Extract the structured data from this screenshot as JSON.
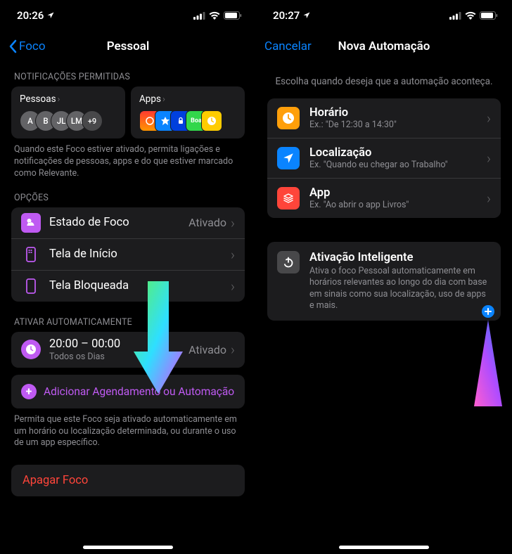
{
  "left": {
    "status": {
      "time": "20:26"
    },
    "nav": {
      "back": "Foco",
      "title": "Pessoal"
    },
    "notif": {
      "header": "NOTIFICAÇÕES PERMITIDAS",
      "pessoas_label": "Pessoas",
      "apps_label": "Apps",
      "avatars": [
        "A",
        "B",
        "JL",
        "LM"
      ],
      "avatar_more": "+9",
      "footnote": "Quando este Foco estiver ativado, permita ligações e notificações de pessoas, apps e do que estiver marcado como Relevante."
    },
    "options": {
      "header": "OPÇÕES",
      "estado": {
        "title": "Estado de Foco",
        "trail": "Ativado"
      },
      "home": {
        "title": "Tela de Início"
      },
      "lock": {
        "title": "Tela Bloqueada"
      }
    },
    "auto": {
      "header": "ATIVAR AUTOMATICAMENTE",
      "schedule": {
        "title": "20:00 – 00:00",
        "sub": "Todos os Dias",
        "trail": "Ativado"
      },
      "add": "Adicionar Agendamento ou Automação",
      "footnote": "Permita que este Foco seja ativado automaticamente em um horário ou localização determinada, ou durante o uso de um app específico."
    },
    "delete": "Apagar Foco"
  },
  "right": {
    "status": {
      "time": "20:27"
    },
    "nav": {
      "cancel": "Cancelar",
      "title": "Nova Automação"
    },
    "subtitle": "Escolha quando deseja que a automação aconteça.",
    "options": {
      "time": {
        "title": "Horário",
        "sub": "Ex.: \"De 12:30 a 14:30\""
      },
      "location": {
        "title": "Localização",
        "sub": "Ex. \"Quando eu chegar ao Trabalho\""
      },
      "app": {
        "title": "App",
        "sub": "Ex. \"Ao abrir o app Livros\""
      }
    },
    "smart": {
      "title": "Ativação Inteligente",
      "desc": "Ativa o foco Pessoal automaticamente em horários relevantes ao longo do dia com base em sinais como sua localização, uso de apps e mais."
    }
  }
}
